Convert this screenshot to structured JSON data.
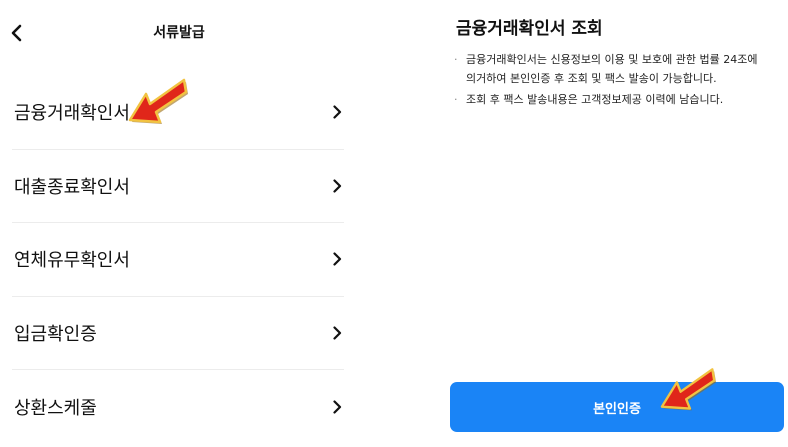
{
  "left_screen": {
    "header": {
      "title": "서류발급",
      "back_icon": "chevron-left-icon"
    },
    "menu_items": [
      {
        "label": "금융거래확인서",
        "icon": "chevron-right-icon"
      },
      {
        "label": "대출종료확인서",
        "icon": "chevron-right-icon"
      },
      {
        "label": "연체유무확인서",
        "icon": "chevron-right-icon"
      },
      {
        "label": "입금확인증",
        "icon": "chevron-right-icon"
      },
      {
        "label": "상환스케줄",
        "icon": "chevron-right-icon"
      }
    ]
  },
  "right_screen": {
    "title": "금융거래확인서 조회",
    "notes": [
      {
        "bullet": "·",
        "line1": "금융거래확인서는 신용정보의 이용 및 보호에 관한 법률 24조에",
        "line2": "의거하여 본인인증 후 조회 및 팩스 발송이 가능합니다."
      },
      {
        "bullet": "·",
        "line1": "조회 후 팩스 발송내용은 고객정보제공 이력에 남습니다.",
        "line2": ""
      }
    ],
    "button_label": "본인인증",
    "button_color": "#1a84f6"
  },
  "annotations": {
    "arrow_icon": "red-pointer-arrow-icon",
    "arrow_color": "#e0261a"
  }
}
